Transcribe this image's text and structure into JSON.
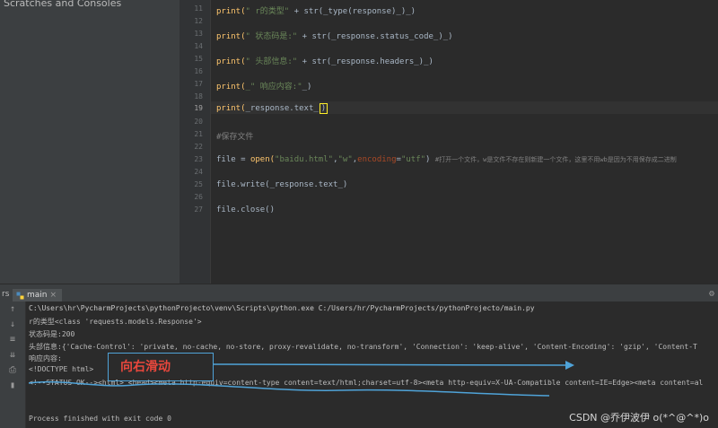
{
  "project_panel": {
    "item": "Scratches and Consoles"
  },
  "editor": {
    "line_numbers": [
      "11",
      "12",
      "13",
      "14",
      "15",
      "16",
      "17",
      "18",
      "19",
      "20",
      "21",
      "22",
      "23",
      "24",
      "25",
      "26",
      "27"
    ],
    "current_line": "19",
    "line11": {
      "a": "print(",
      "b": "\" r的类型\"",
      "c": " + str(_type(response)_)_)"
    },
    "line13": {
      "a": "print(",
      "b": "\" 状态码是:\"",
      "c": " + str(_response.status_code_)_)"
    },
    "line15": {
      "a": "print(",
      "b": "\" 头部信息:\"",
      "c": " + str(_response.headers_)_)"
    },
    "line17": {
      "a": "print(",
      "b": "_\" 响应内容:\"",
      "c": "_)"
    },
    "line19": {
      "a": "print(",
      "b": "_response.text_",
      "c": ")"
    },
    "line21": {
      "a": "#保存文件"
    },
    "line23": {
      "a": "file = ",
      "b": "open(",
      "c": "\"baidu.html\"",
      "d": ",",
      "e": "\"w\"",
      "f": ",",
      "g": "encoding",
      "h": "=",
      "i": "\"utf\"",
      "j": ") ",
      "k": "#打开一个文件，w是文件不存在则新建一个文件，这里不用wb是因为不用保存成二进制"
    },
    "line25": {
      "a": "file.write(_response.text_)"
    },
    "line27": {
      "a": "file.close()"
    }
  },
  "run_panel": {
    "side_label": "rs",
    "tab_label": "main",
    "lines": [
      "C:\\Users\\hr\\PycharmProjects\\pythonProjecto\\venv\\Scripts\\python.exe C:/Users/hr/PycharmProjects/pythonProjecto/main.py",
      " r的类型<class 'requests.models.Response'>",
      " 状态码是:200",
      " 头部信息:{'Cache-Control': 'private, no-cache, no-store, proxy-revalidate, no-transform', 'Connection': 'keep-alive', 'Content-Encoding': 'gzip', 'Content-T",
      " 响应内容:",
      "<!DOCTYPE html>",
      "<!--STATUS OK--><html> <head><meta http-equiv=content-type content=text/html;charset=utf-8><meta http-equiv=X-UA-Compatible content=IE=Edge><meta content=al",
      "",
      "Process finished with exit code 0"
    ]
  },
  "annotation": {
    "text": "向右滑动"
  },
  "watermark": "CSDN @乔伊波伊 o(*^@^*)o",
  "colors": {
    "background": "#2b2b2b",
    "string": "#6a8759",
    "function": "#ffc66d",
    "annotation_box": "#4fa3d8",
    "annotation_text": "#e8473c"
  }
}
